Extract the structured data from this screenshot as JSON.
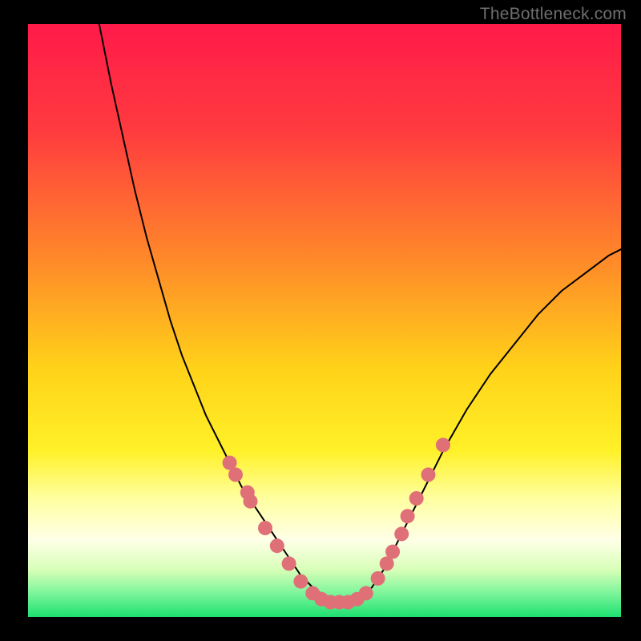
{
  "watermark": "TheBottleneck.com",
  "chart_data": {
    "type": "line",
    "title": "",
    "xlabel": "",
    "ylabel": "",
    "xlim": [
      0,
      100
    ],
    "ylim": [
      0,
      100
    ],
    "background_gradient_stops": [
      {
        "offset": 0,
        "color": "#ff1a49"
      },
      {
        "offset": 18,
        "color": "#ff3b3f"
      },
      {
        "offset": 40,
        "color": "#ff8a29"
      },
      {
        "offset": 58,
        "color": "#ffd219"
      },
      {
        "offset": 72,
        "color": "#fff128"
      },
      {
        "offset": 80,
        "color": "#ffffa0"
      },
      {
        "offset": 87,
        "color": "#ffffe8"
      },
      {
        "offset": 92,
        "color": "#d8ffb8"
      },
      {
        "offset": 96,
        "color": "#7cf59a"
      },
      {
        "offset": 100,
        "color": "#1de070"
      }
    ],
    "series": [
      {
        "name": "v-curve",
        "stroke": "#000000",
        "stroke_width": 2,
        "x": [
          12,
          14,
          16,
          18,
          20,
          22,
          24,
          26,
          28,
          30,
          32,
          34,
          36,
          38,
          40,
          42,
          44,
          46,
          48,
          50,
          52,
          54,
          56,
          58,
          60,
          62,
          64,
          66,
          68,
          70,
          74,
          78,
          82,
          86,
          90,
          94,
          98,
          100
        ],
        "y": [
          100,
          90,
          81,
          72,
          64,
          57,
          50,
          44,
          39,
          34,
          30,
          26,
          22,
          19,
          16,
          13,
          10,
          7,
          5,
          3.5,
          2.5,
          2.5,
          3,
          5,
          8,
          12,
          16,
          20,
          24,
          28,
          35,
          41,
          46,
          51,
          55,
          58,
          61,
          62
        ]
      }
    ],
    "markers": {
      "color": "#e07078",
      "radius": 9,
      "points": [
        {
          "x": 34,
          "y": 26
        },
        {
          "x": 35,
          "y": 24
        },
        {
          "x": 37,
          "y": 21
        },
        {
          "x": 37.5,
          "y": 19.5
        },
        {
          "x": 40,
          "y": 15
        },
        {
          "x": 42,
          "y": 12
        },
        {
          "x": 44,
          "y": 9
        },
        {
          "x": 46,
          "y": 6
        },
        {
          "x": 48,
          "y": 4
        },
        {
          "x": 49.5,
          "y": 3
        },
        {
          "x": 51,
          "y": 2.5
        },
        {
          "x": 52.5,
          "y": 2.5
        },
        {
          "x": 54,
          "y": 2.5
        },
        {
          "x": 55.5,
          "y": 3
        },
        {
          "x": 57,
          "y": 4
        },
        {
          "x": 59,
          "y": 6.5
        },
        {
          "x": 60.5,
          "y": 9
        },
        {
          "x": 61.5,
          "y": 11
        },
        {
          "x": 63,
          "y": 14
        },
        {
          "x": 64,
          "y": 17
        },
        {
          "x": 65.5,
          "y": 20
        },
        {
          "x": 67.5,
          "y": 24
        },
        {
          "x": 70,
          "y": 29
        }
      ]
    }
  }
}
